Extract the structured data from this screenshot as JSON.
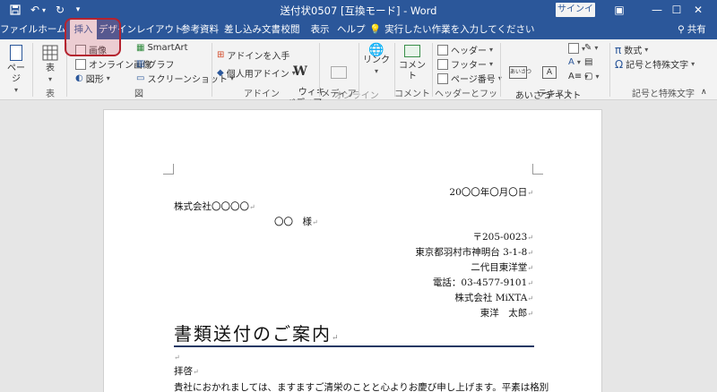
{
  "titlebar": {
    "title": "送付状0507 [互換モード] - Word",
    "signin": "サインイン",
    "qat_icons": [
      "save-icon",
      "undo-icon",
      "redo-icon",
      "customize-icon"
    ],
    "window_buttons": [
      "ribbon-display-icon",
      "minimize-icon",
      "maximize-icon",
      "close-icon"
    ]
  },
  "tabs": [
    {
      "label": "ファイル",
      "active": false
    },
    {
      "label": "ホーム",
      "active": false
    },
    {
      "label": "挿入",
      "active": true
    },
    {
      "label": "デザイン",
      "active": false
    },
    {
      "label": "レイアウト",
      "active": false
    },
    {
      "label": "参考資料",
      "active": false
    },
    {
      "label": "差し込み文書",
      "active": false
    },
    {
      "label": "校閲",
      "active": false
    },
    {
      "label": "表示",
      "active": false
    },
    {
      "label": "ヘルプ",
      "active": false
    }
  ],
  "tell_me": "実行したい作業を入力してください",
  "share": "共有",
  "ribbon": {
    "page": "ページ",
    "table": "表",
    "image": "画像",
    "online_image": "オンライン画像",
    "shapes": "図形",
    "smartart": "SmartArt",
    "graph": "グラフ",
    "screenshot": "スクリーンショット",
    "get_addins": "アドインを入手",
    "my_addins": "個人用アドイン",
    "wikipedia": "ウィキ\nペディア",
    "online_video": "オンライン\nビデオ",
    "link": "リンク",
    "comment": "コメント",
    "header": "ヘッダー",
    "footer": "フッター",
    "page_number": "ページ番号",
    "textbox_label": "あいさつ\n文",
    "text_box": "テキスト\nボックス",
    "equation": "数式",
    "symbol": "記号と特殊文字",
    "groups": {
      "table": "表",
      "illustrations": "図",
      "addins": "アドイン",
      "media": "メディア",
      "comments": "コメント",
      "header_footer": "ヘッダーとフッター",
      "text": "テキスト",
      "symbols": "記号と特殊文字"
    }
  },
  "document": {
    "date": "20〇〇年〇月〇日",
    "company_to": "株式会社〇〇〇〇",
    "person_to": "〇〇　様",
    "postal": "〒205-0023",
    "address1": "東京都羽村市神明台 3-1-8",
    "address2": "二代目東洋堂",
    "phone": "電話：03-4577-9101",
    "company_from": "株式会社 MiXTA",
    "sender": "東洋　太郎",
    "heading": "書類送付のご案内",
    "greeting": "拝啓",
    "body": "貴社におかれましては、ますますご清栄のことと心よりお慶び申し上げます。平素は格別"
  }
}
